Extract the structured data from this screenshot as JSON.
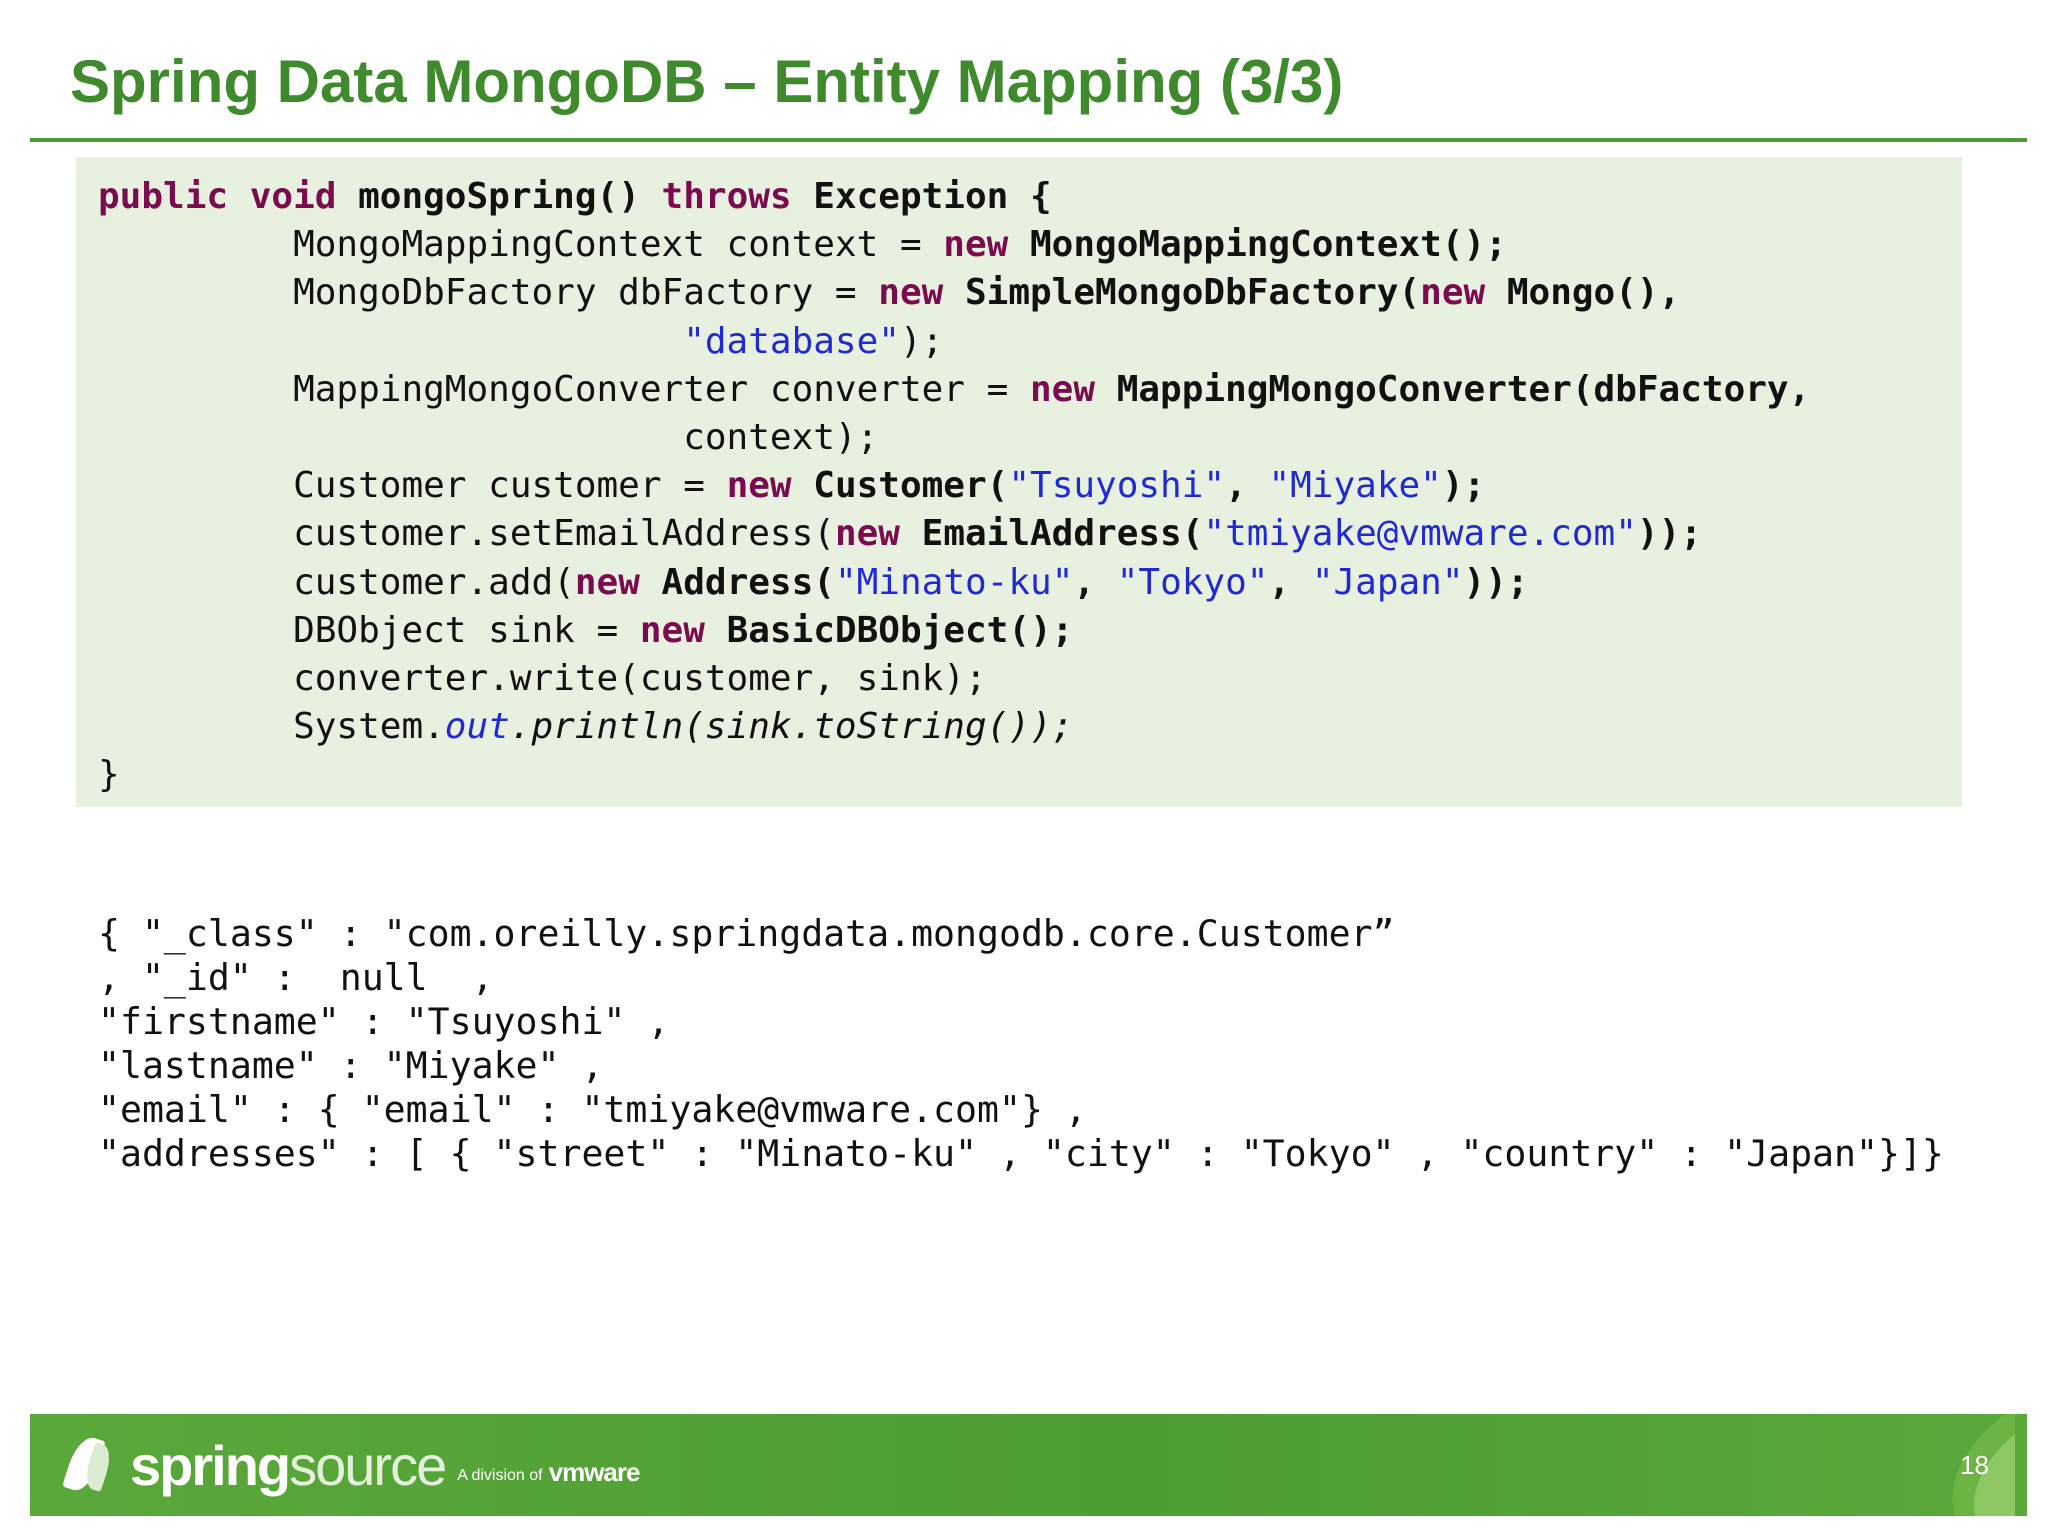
{
  "slide": {
    "title": "Spring Data MongoDB – Entity Mapping (3/3)",
    "page_number": "18"
  },
  "code": {
    "l1": {
      "a": "public",
      "b": " ",
      "c": "void",
      "d": " mongoSpring() ",
      "e": "throws",
      "f": " Exception {"
    },
    "l2": {
      "indent": "         ",
      "a": "MongoMappingContext context = ",
      "b": "new",
      "c": " MongoMappingContext();"
    },
    "l3": {
      "indent": "         ",
      "a": "MongoDbFactory dbFactory = ",
      "b": "new",
      "c": " SimpleMongoDbFactory(",
      "d": "new",
      "e": " Mongo(),"
    },
    "l4": {
      "indent": "                           ",
      "a": "\"database\"",
      "b": ");"
    },
    "l5": {
      "indent": "         ",
      "a": "MappingMongoConverter converter = ",
      "b": "new",
      "c": " MappingMongoConverter(dbFactory,"
    },
    "l6": {
      "indent": "                           ",
      "a": "context);"
    },
    "l7": {
      "indent": "         ",
      "a": "Customer customer = ",
      "b": "new",
      "c": " Customer(",
      "d": "\"Tsuyoshi\"",
      "e": ", ",
      "f": "\"Miyake\"",
      "g": ");"
    },
    "l8": {
      "indent": "         ",
      "a": "customer.setEmailAddress(",
      "b": "new",
      "c": " EmailAddress(",
      "d": "\"tmiyake@vmware.com\"",
      "e": "));"
    },
    "l9": {
      "indent": "         ",
      "a": "customer.add(",
      "b": "new",
      "c": " Address(",
      "d": "\"Minato-ku\"",
      "e": ", ",
      "f": "\"Tokyo\"",
      "g": ", ",
      "h": "\"Japan\"",
      "i": "));"
    },
    "l10": {
      "indent": "         ",
      "a": "DBObject sink = ",
      "b": "new",
      "c": " BasicDBObject();"
    },
    "l11": {
      "indent": "         ",
      "a": "converter.write(customer, sink);"
    },
    "l12": {
      "indent": "         ",
      "a": "System.",
      "b": "out",
      "c": ".println(sink.toString());"
    },
    "l13": {
      "a": "}"
    }
  },
  "output": {
    "lines": [
      "{ \"_class\" : \"com.oreilly.springdata.mongodb.core.Customer”",
      ", \"_id\" :  null  ,",
      "\"firstname\" : \"Tsuyoshi\" ,",
      "\"lastname\" : \"Miyake\" ,",
      "\"email\" : { \"email\" : \"tmiyake@vmware.com\"} ,",
      "\"addresses\" : [ { \"street\" : \"Minato-ku\" , \"city\" : \"Tokyo\" , \"country\" : \"Japan\"}]}"
    ]
  },
  "footer": {
    "brand_strong": "spring",
    "brand_light": "source",
    "division": "A division of",
    "parent_brand": "vmware",
    "icons": [
      "leaf-icon",
      "swoosh-icon"
    ]
  },
  "colors": {
    "title": "#3f8a2d",
    "keyword": "#7b0a4e",
    "string": "#1f2ad6",
    "code_background": "#e8f1e0",
    "footer": "#4e9d33"
  }
}
